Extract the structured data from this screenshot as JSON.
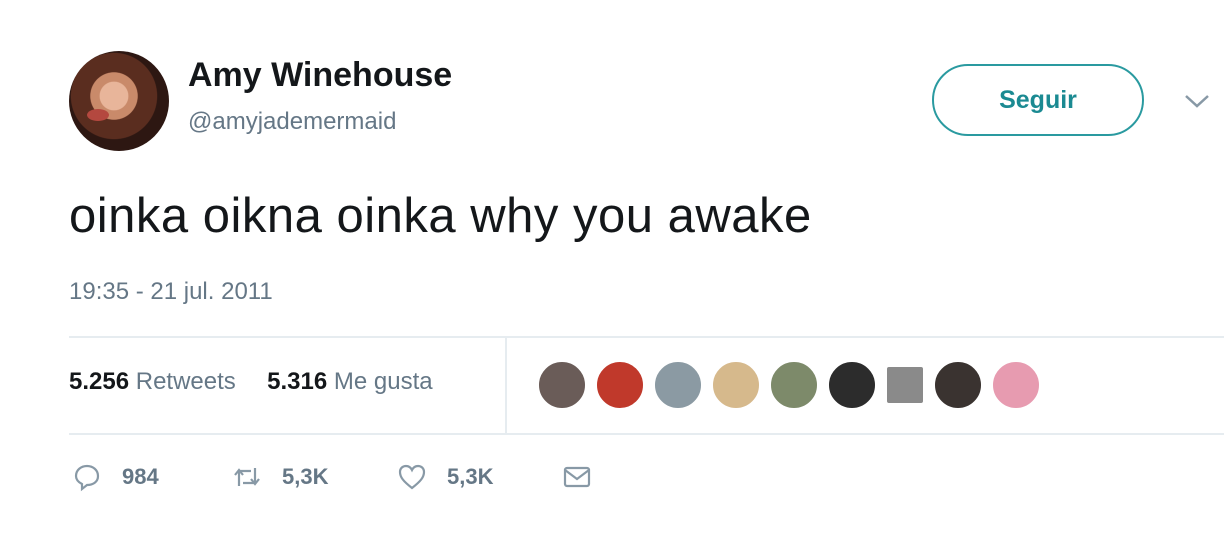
{
  "author": {
    "name": "Amy Winehouse",
    "handle": "@amyjademermaid"
  },
  "follow_button": {
    "label": "Seguir"
  },
  "menu": {
    "icon": "chevron-down-icon"
  },
  "tweet": {
    "text": "oinka oikna oinka why you awake",
    "timestamp": "19:35 - 21 jul. 2011"
  },
  "stats": {
    "retweets_count": "5.256",
    "retweets_label": "Retweets",
    "likes_count": "5.316",
    "likes_label": "Me gusta"
  },
  "likers": [
    {
      "color": "#6a5c58"
    },
    {
      "color": "#c0392b"
    },
    {
      "color": "#8b9aa3"
    },
    {
      "color": "#d6b98c"
    },
    {
      "color": "#7d8a6a"
    },
    {
      "color": "#2c2c2c"
    },
    {
      "color": "#8a8a8a"
    },
    {
      "color": "#3a3330"
    },
    {
      "color": "#e79bb0"
    }
  ],
  "actions": {
    "reply_count": "984",
    "retweet_count": "5,3K",
    "like_count": "5,3K"
  },
  "colors": {
    "accent": "#1b8a92",
    "muted": "#657786",
    "divider": "#e6ecf0"
  }
}
